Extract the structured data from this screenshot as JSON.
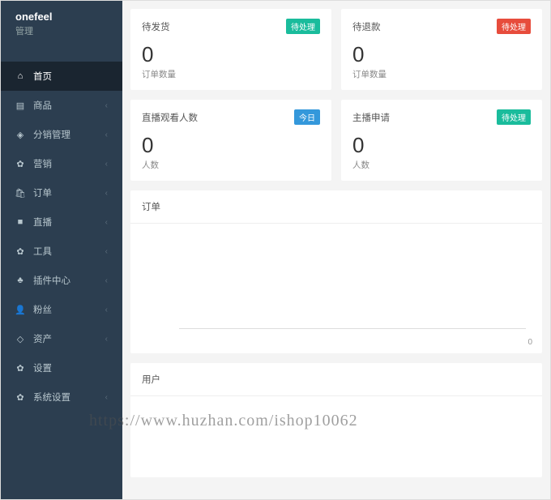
{
  "brand": {
    "name": "onefeel",
    "sub": "管理"
  },
  "nav": [
    {
      "icon": "⌂",
      "label": "首页",
      "active": true,
      "expandable": false
    },
    {
      "icon": "▤",
      "label": "商品",
      "active": false,
      "expandable": true
    },
    {
      "icon": "◈",
      "label": "分销管理",
      "active": false,
      "expandable": true
    },
    {
      "icon": "✿",
      "label": "营销",
      "active": false,
      "expandable": true
    },
    {
      "icon": "🛍",
      "label": "订单",
      "active": false,
      "expandable": true
    },
    {
      "icon": "■",
      "label": "直播",
      "active": false,
      "expandable": true
    },
    {
      "icon": "✿",
      "label": "工具",
      "active": false,
      "expandable": true
    },
    {
      "icon": "♣",
      "label": "插件中心",
      "active": false,
      "expandable": true
    },
    {
      "icon": "👤",
      "label": "粉丝",
      "active": false,
      "expandable": true
    },
    {
      "icon": "◇",
      "label": "资产",
      "active": false,
      "expandable": true
    },
    {
      "icon": "✿",
      "label": "设置",
      "active": false,
      "expandable": false
    },
    {
      "icon": "✿",
      "label": "系统设置",
      "active": false,
      "expandable": true
    }
  ],
  "stats_row1": [
    {
      "title": "待发货",
      "badge": "待处理",
      "badge_color": "green",
      "value": "0",
      "sub": "订单数量"
    },
    {
      "title": "待退款",
      "badge": "待处理",
      "badge_color": "red",
      "value": "0",
      "sub": "订单数量"
    }
  ],
  "stats_row2": [
    {
      "title": "直播观看人数",
      "badge": "今日",
      "badge_color": "blue",
      "value": "0",
      "sub": "人数"
    },
    {
      "title": "主播申请",
      "badge": "待处理",
      "badge_color": "green",
      "value": "0",
      "sub": "人数"
    }
  ],
  "panel_orders": {
    "title": "订单",
    "axis_zero": "0"
  },
  "panel_users": {
    "title": "用户"
  },
  "chart_data": [
    {
      "type": "line",
      "title": "订单",
      "x": [],
      "values": [],
      "ylim": [
        0,
        0
      ]
    },
    {
      "type": "line",
      "title": "用户",
      "x": [],
      "values": [],
      "ylim": [
        0,
        0
      ]
    }
  ],
  "watermark": "https://www.huzhan.com/ishop10062"
}
